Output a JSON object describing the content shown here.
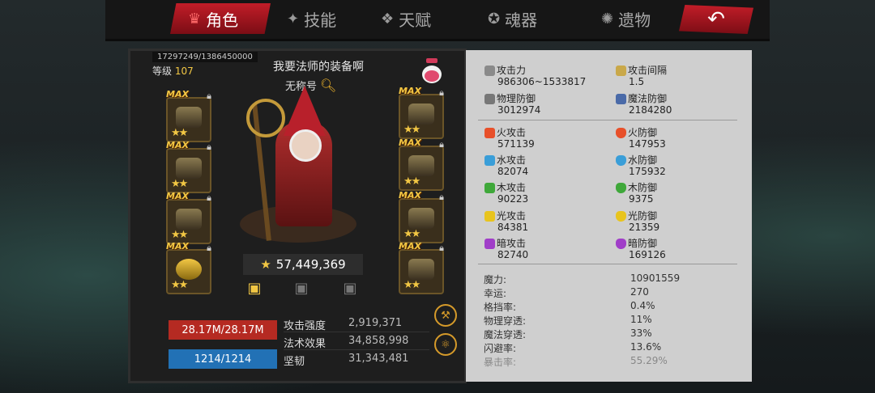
{
  "nav": {
    "tabs": [
      {
        "label": "角色",
        "icon": "crown-icon",
        "active": true
      },
      {
        "label": "技能",
        "icon": "skill-icon",
        "active": false
      },
      {
        "label": "天赋",
        "icon": "talent-icon",
        "active": false
      },
      {
        "label": "魂器",
        "icon": "soul-icon",
        "active": false
      },
      {
        "label": "遗物",
        "icon": "relic-icon",
        "active": false
      }
    ],
    "back_icon": "back-arrow-icon"
  },
  "character": {
    "exp": "17297249/1386450000",
    "level_label": "等级",
    "level": "107",
    "name": "我要法师的装备啊",
    "title": "无称号",
    "power": "57,449,369"
  },
  "equipment": {
    "max_label": "MAX",
    "slots": [
      {
        "side": "left",
        "stars": "★★"
      },
      {
        "side": "left",
        "stars": "★★"
      },
      {
        "side": "left",
        "stars": "★★"
      },
      {
        "side": "left",
        "stars": "★★"
      },
      {
        "side": "right",
        "stars": "★★"
      },
      {
        "side": "right",
        "stars": "★★"
      },
      {
        "side": "right",
        "stars": "★★"
      },
      {
        "side": "right",
        "stars": "★★"
      }
    ]
  },
  "bars": {
    "hp": "28.17M/28.17M",
    "mp": "1214/1214"
  },
  "base_stats": [
    {
      "label": "攻击强度",
      "value": "2,919,371"
    },
    {
      "label": "法术效果",
      "value": "34,858,998"
    },
    {
      "label": "坚韧",
      "value": "31,343,481"
    }
  ],
  "stats": {
    "attack": {
      "label": "攻击力",
      "value": "986306~1533817"
    },
    "attack_speed": {
      "label": "攻击间隔",
      "value": "1.5"
    },
    "phys_def": {
      "label": "物理防御",
      "value": "3012974"
    },
    "magic_def": {
      "label": "魔法防御",
      "value": "2184280"
    },
    "fire_atk": {
      "label": "火攻击",
      "value": "571139"
    },
    "fire_def": {
      "label": "火防御",
      "value": "147953"
    },
    "water_atk": {
      "label": "水攻击",
      "value": "82074"
    },
    "water_def": {
      "label": "水防御",
      "value": "175932"
    },
    "wood_atk": {
      "label": "木攻击",
      "value": "90223"
    },
    "wood_def": {
      "label": "木防御",
      "value": "9375"
    },
    "light_atk": {
      "label": "光攻击",
      "value": "84381"
    },
    "light_def": {
      "label": "光防御",
      "value": "21359"
    },
    "dark_atk": {
      "label": "暗攻击",
      "value": "82740"
    },
    "dark_def": {
      "label": "暗防御",
      "value": "169126"
    }
  },
  "misc_stats": [
    {
      "label": "魔力:",
      "value": "10901559"
    },
    {
      "label": "幸运:",
      "value": "270"
    },
    {
      "label": "格挡率:",
      "value": "0.4%"
    },
    {
      "label": "物理穿透:",
      "value": "11%"
    },
    {
      "label": "魔法穿透:",
      "value": "33%"
    },
    {
      "label": "闪避率:",
      "value": "13.6%"
    },
    {
      "label": "暴击率:",
      "value": "55.29%"
    }
  ],
  "colors": {
    "accent_red": "#c21d28",
    "gold": "#f2c744",
    "hp_red": "#b52a22",
    "mp_blue": "#2271b5",
    "fire": "#e8502a",
    "water": "#3a9ed8",
    "wood": "#3fa83a",
    "light": "#e8c41e",
    "dark": "#a03ec8"
  }
}
